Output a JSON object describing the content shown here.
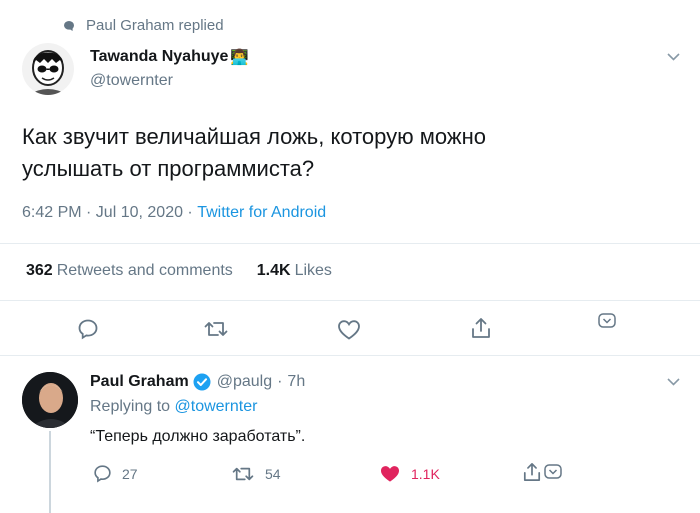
{
  "context": {
    "replied_label": "Paul Graham replied"
  },
  "main_tweet": {
    "author_name": "Tawanda Nyahuye",
    "author_handle": "@towernter",
    "author_emoji": "👨‍💻",
    "text": "Как звучит величайшая ложь, которую можно услышать от программиста?",
    "timestamp": "6:42 PM · Jul 10, 2020 · ",
    "source": "Twitter for Android",
    "retweets_count": "362",
    "retweets_label": "Retweets and comments",
    "likes_count": "1.4K",
    "likes_label": "Likes"
  },
  "reply_tweet": {
    "author_name": "Paul Graham",
    "author_handle": "@paulg",
    "separator": "·",
    "time": "7h",
    "replying_prefix": "Replying to ",
    "replying_handle": "@towernter",
    "text": "“Теперь должно заработать”.",
    "reply_count": "27",
    "retweet_count": "54",
    "like_count": "1.1K"
  },
  "colors": {
    "accent": "#1b95e0",
    "like": "#e0245e",
    "muted": "#657786",
    "divider": "#e6ecf0",
    "verified": "#1da1f2"
  },
  "icons": [
    "comment-bubble-icon",
    "retweet-icon",
    "heart-icon",
    "share-icon",
    "chevron-down-icon",
    "verified-badge-icon"
  ]
}
